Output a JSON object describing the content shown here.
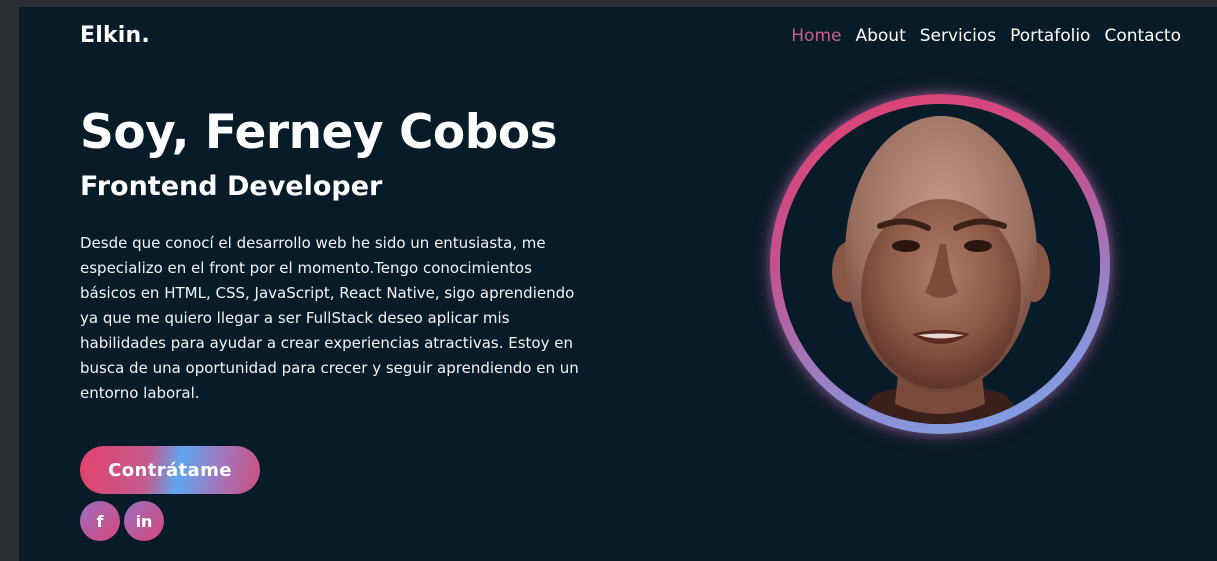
{
  "header": {
    "logo": "Elkin.",
    "nav": [
      {
        "label": "Home",
        "active": true
      },
      {
        "label": "About",
        "active": false
      },
      {
        "label": "Servicios",
        "active": false
      },
      {
        "label": "Portafolio",
        "active": false
      },
      {
        "label": "Contacto",
        "active": false
      }
    ]
  },
  "hero": {
    "title": "Soy, Ferney Cobos",
    "subtitle": "Frontend Developer",
    "description": "Desde que conocí el desarrollo web he sido un entusiasta, me especializo en el front por el momento.Tengo conocimientos básicos en HTML, CSS, JavaScript, React Native, sigo aprendiendo ya que me quiero llegar a ser FullStack deseo aplicar mis habilidades para ayudar a crear experiencias atractivas. Estoy en busca de una oportunidad para crecer y seguir aprendiendo en un entorno laboral.",
    "cta_label": "Contrátame"
  },
  "social": {
    "facebook": {
      "icon": "facebook-icon",
      "glyph": "f"
    },
    "linkedin": {
      "icon": "linkedin-icon",
      "glyph": "in"
    }
  },
  "colors": {
    "background": "#081b29",
    "accent_pink": "#e4416a",
    "accent_blue": "#5fa7ef",
    "active_nav": "#c95b95"
  }
}
